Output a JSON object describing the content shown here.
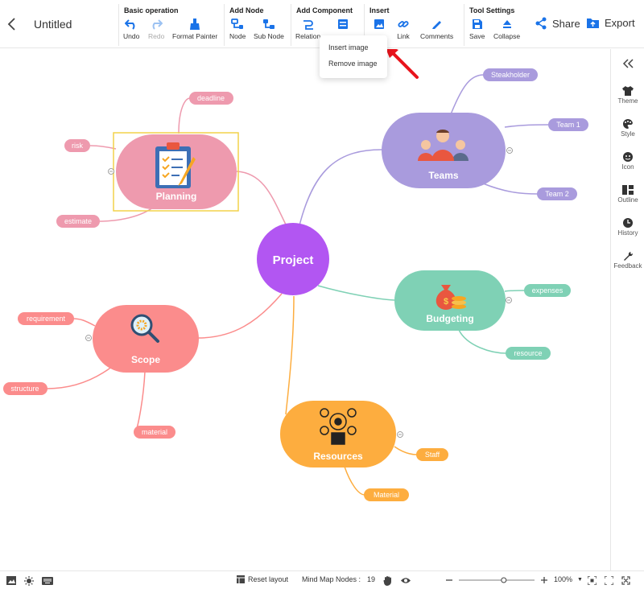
{
  "header": {
    "title": "Untitled",
    "groups": {
      "basic": {
        "title": "Basic operation",
        "undo": "Undo",
        "redo": "Redo",
        "format_painter": "Format Painter"
      },
      "add_node": {
        "title": "Add Node",
        "node": "Node",
        "sub_node": "Sub Node"
      },
      "add_component": {
        "title": "Add Component",
        "relation": "Relation"
      },
      "insert": {
        "title": "Insert",
        "link": "Link",
        "comments": "Comments"
      },
      "tool_settings": {
        "title": "Tool Settings",
        "save": "Save",
        "collapse": "Collapse"
      }
    },
    "share": "Share",
    "export": "Export"
  },
  "insert_dropdown": {
    "items": [
      "Insert image",
      "Remove image"
    ]
  },
  "mindmap": {
    "center": "Project",
    "branches": {
      "planning": {
        "label": "Planning",
        "color": "#ee9aae",
        "children": [
          "deadline",
          "risk",
          "estimate"
        ]
      },
      "teams": {
        "label": "Teams",
        "color": "#a99bdd",
        "children": [
          "Steakholder",
          "Team 1",
          "Team 2"
        ]
      },
      "budgeting": {
        "label": "Budgeting",
        "color": "#7fd1b5",
        "children": [
          "expenses",
          "resource"
        ]
      },
      "scope": {
        "label": "Scope",
        "color": "#fb8c8c",
        "children": [
          "requirement",
          "structure",
          "material"
        ]
      },
      "resources": {
        "label": "Resources",
        "color": "#fdad3f",
        "children": [
          "Staff",
          "Material"
        ]
      }
    },
    "center_color": "#b256f2"
  },
  "right_panel": {
    "items": [
      "Theme",
      "Style",
      "Icon",
      "Outline",
      "History",
      "Feedback"
    ]
  },
  "statusbar": {
    "reset_layout": "Reset layout",
    "node_count_label": "Mind Map Nodes :",
    "node_count": "19",
    "zoom": "100%",
    "zoom_level": 0.6
  }
}
